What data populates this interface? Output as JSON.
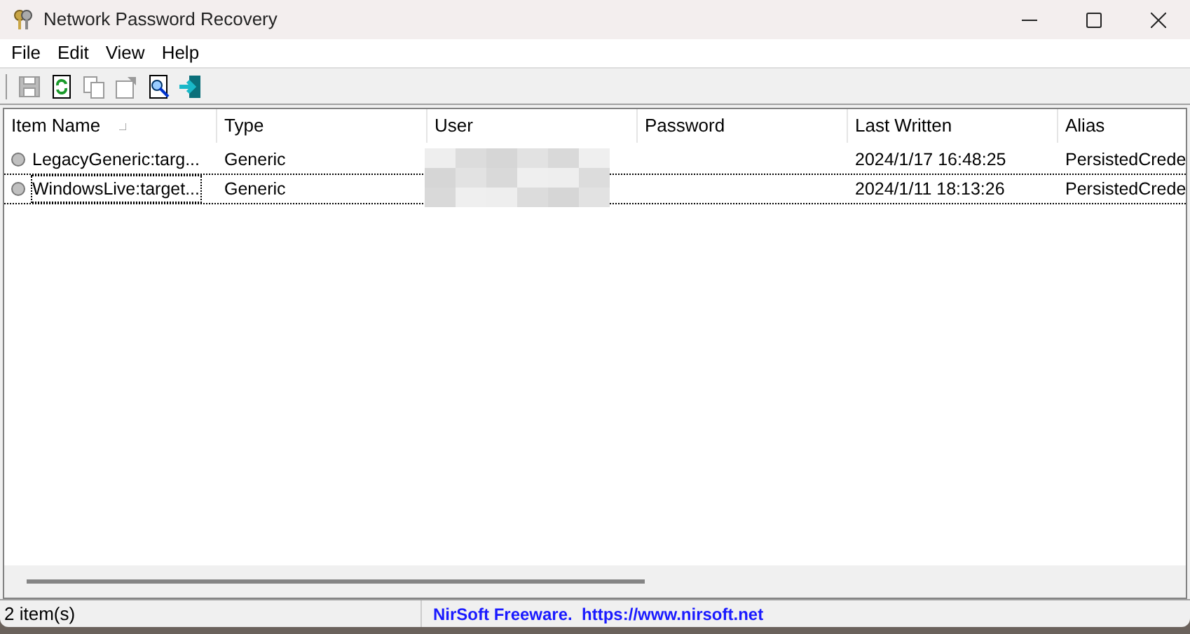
{
  "window": {
    "title": "Network Password Recovery"
  },
  "menu": [
    "File",
    "Edit",
    "View",
    "Help"
  ],
  "toolbar": [
    {
      "kind": "save",
      "disabled": true
    },
    {
      "kind": "refresh",
      "disabled": false
    },
    {
      "kind": "copy",
      "disabled": true
    },
    {
      "kind": "properties",
      "disabled": true
    },
    {
      "kind": "find",
      "disabled": false
    },
    {
      "kind": "exit",
      "disabled": false
    }
  ],
  "table": {
    "columns": [
      {
        "label": "Item Name",
        "sorted": true
      },
      {
        "label": "Type",
        "sorted": false
      },
      {
        "label": "User",
        "sorted": false
      },
      {
        "label": "Password",
        "sorted": false
      },
      {
        "label": "Last Written",
        "sorted": false
      },
      {
        "label": "Alias",
        "sorted": false
      }
    ],
    "rows": [
      {
        "item_name": "LegacyGeneric:targ...",
        "type": "Generic",
        "last_written": "2024/1/17 16:48:25",
        "alias": "PersistedCrede",
        "focused": false
      },
      {
        "item_name": "WindowsLive:target...",
        "type": "Generic",
        "last_written": "2024/1/11 18:13:26",
        "alias": "PersistedCrede",
        "focused": true
      }
    ]
  },
  "status_bar": {
    "count": "2 item(s)",
    "credit": "NirSoft Freeware.  https://www.nirsoft.net"
  }
}
